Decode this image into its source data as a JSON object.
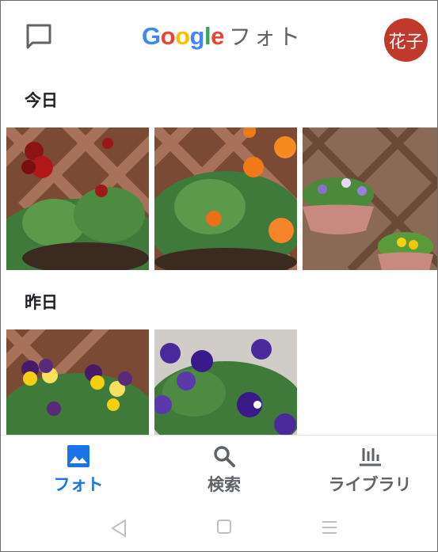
{
  "header": {
    "logo_text": "Google",
    "product_name": "フォト",
    "avatar_text": "花子",
    "colors": {
      "blue": "#4285F4",
      "red": "#EA4335",
      "yellow": "#FBBC05",
      "green": "#34A853",
      "avatar": "#c0392b"
    }
  },
  "sections": [
    {
      "label": "今日"
    },
    {
      "label": "昨日"
    }
  ],
  "bottom_nav": {
    "items": [
      {
        "label": "フォト",
        "icon": "photo-icon",
        "active": true
      },
      {
        "label": "検索",
        "icon": "search-icon",
        "active": false
      },
      {
        "label": "ライブラリ",
        "icon": "library-icon",
        "active": false
      }
    ],
    "active_color": "#1a73e8"
  },
  "system_nav": {
    "icons": [
      "back-icon",
      "home-icon",
      "recents-icon"
    ]
  }
}
